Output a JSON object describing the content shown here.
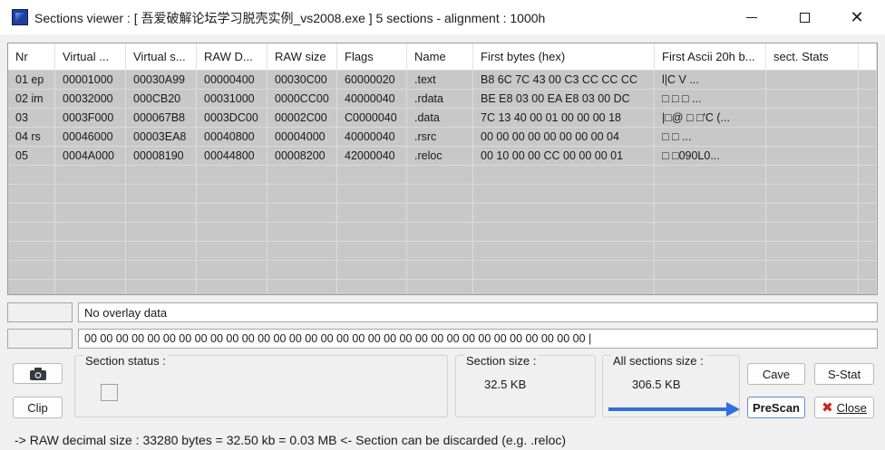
{
  "window": {
    "title": "Sections viewer : [ 吾爱破解论坛学习脱壳实例_vs2008.exe ] 5 sections - alignment : 1000h",
    "minimize_icon": "minimize-icon",
    "maximize_icon": "maximize-icon",
    "close_icon": "close-icon",
    "close_glyph": "✕"
  },
  "table": {
    "headers": [
      "Nr",
      "Virtual ...",
      "Virtual s...",
      "RAW D...",
      "RAW size",
      "Flags",
      "Name",
      "First bytes (hex)",
      "First Ascii 20h b...",
      "sect. Stats"
    ],
    "rows": [
      [
        "01 ep",
        "00001000",
        "00030A99",
        "00000400",
        "00030C00",
        "60000020",
        ".text",
        "B8 6C 7C 43 00 C3 CC CC CC",
        "l|C          V   ...",
        ""
      ],
      [
        "02 im",
        "00032000",
        "000CB20",
        "00031000",
        "0000CC00",
        "40000040",
        ".rdata",
        "BE E8 03 00 EA E8 03 00 DC",
        "□    □    □    ...",
        ""
      ],
      [
        "03",
        "0003F000",
        "000067B8",
        "0003DC00",
        "00002C00",
        "C0000040",
        ".data",
        "7C 13 40 00 01 00 00 00 18",
        "|□@ □    □'C (...",
        ""
      ],
      [
        "04 rs",
        "00046000",
        "00003EA8",
        "00040800",
        "00004000",
        "40000040",
        ".rsrc",
        "00 00 00 00 00 00 00 00 04",
        "          □       □     ...",
        ""
      ],
      [
        "05",
        "0004A000",
        "00008190",
        "00044800",
        "00008200",
        "42000040",
        ".reloc",
        "00 10 00 00 CC 00 00 00 01",
        "  □        □090L0...",
        ""
      ]
    ],
    "empty_rows": 9
  },
  "overlay_text": "No overlay data",
  "bytes_text": "00 00 00 00 00 00 00 00 00 00 00 00 00 00 00 00 00 00 00 00 00 00 00 00 00 00 00 00 00 00 00 00    |",
  "buttons": {
    "camera_icon": "camera-icon",
    "clip": "Clip",
    "cave": "Cave",
    "sstat": "S-Stat",
    "prescan": "PreScan",
    "close": "Close",
    "close_x": "✖"
  },
  "groups": {
    "section_status_label": "Section status :",
    "section_size_label": "Section size :",
    "section_size_value": "32.5 KB",
    "all_sections_label": "All sections size :",
    "all_sections_value": "306.5 KB"
  },
  "status_line": "->   RAW decimal size :       33280 bytes   =     32.50 kb   = 0.03 MB  <- Section can be discarded (e.g. .reloc)",
  "colors": {
    "table_bg": "#c8c8c8",
    "arrow": "#2f6fe0",
    "close_x": "#d02020"
  }
}
